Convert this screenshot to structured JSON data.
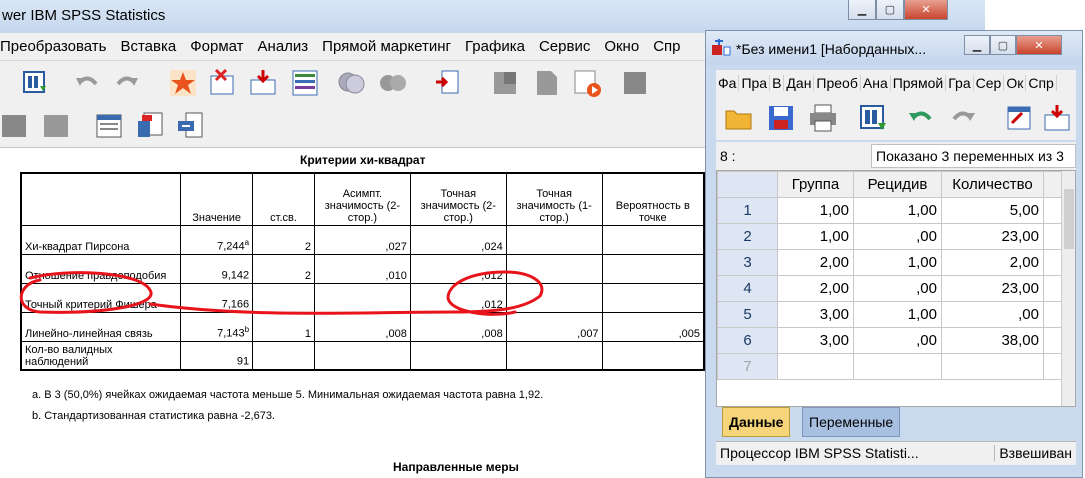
{
  "viewer": {
    "title": "wer IBM SPSS Statistics",
    "menu": [
      "Преобразовать",
      "Вставка",
      "Формат",
      "Анализ",
      "Прямой маркетинг",
      "Графика",
      "Сервис",
      "Окно",
      "Спр"
    ],
    "table_title": "Критерии хи-квадрат",
    "columns": [
      "",
      "Значение",
      "ст.св.",
      "Асимпт. значимость (2-стор.)",
      "Точная значимость (2-стор.)",
      "Точная значимость (1-стор.)",
      "Вероятность в точке"
    ],
    "rows": [
      {
        "label": "Хи-квадрат Пирсона",
        "value": "7,244",
        "sup": "a",
        "df": "2",
        "asymp": ",027",
        "exact2": ",024",
        "exact1": "",
        "prob": ""
      },
      {
        "label": "Отношение правдоподобия",
        "value": "9,142",
        "sup": "",
        "df": "2",
        "asymp": ",010",
        "exact2": ",012",
        "exact1": "",
        "prob": ""
      },
      {
        "label": "Точный критерий Фишера",
        "value": "7,166",
        "sup": "",
        "df": "",
        "asymp": "",
        "exact2": ",012",
        "exact1": "",
        "prob": ""
      },
      {
        "label": "Линейно-линейная связь",
        "value": "7,143",
        "sup": "b",
        "df": "1",
        "asymp": ",008",
        "exact2": ",008",
        "exact1": ",007",
        "prob": ",005"
      },
      {
        "label": "Кол-во валидных наблюдений",
        "value": "91",
        "sup": "",
        "df": "",
        "asymp": "",
        "exact2": "",
        "exact1": "",
        "prob": ""
      }
    ],
    "footnote_a": "a. В 3 (50,0%) ячейках ожидаемая частота меньше 5. Минимальная ожидаемая частота равна 1,92.",
    "footnote_b": "b. Стандартизованная статистика равна -2,673.",
    "next_title": "Направленные меры"
  },
  "editor": {
    "title": "*Без имени1 [Наборданных...",
    "menu": [
      "Фа",
      "Пра",
      "В",
      "Дан",
      "Преоб",
      "Ана",
      "Прямой",
      "Гра",
      "Сер",
      "Ок",
      "Спр"
    ],
    "cell_ref": "8 :",
    "shown_text": "Показано 3 переменных из 3",
    "columns": [
      "Группа",
      "Рецидив",
      "Количество"
    ],
    "rows": [
      {
        "n": "1",
        "c1": "1,00",
        "c2": "1,00",
        "c3": "5,00"
      },
      {
        "n": "2",
        "c1": "1,00",
        "c2": ",00",
        "c3": "23,00"
      },
      {
        "n": "3",
        "c1": "2,00",
        "c2": "1,00",
        "c3": "2,00"
      },
      {
        "n": "4",
        "c1": "2,00",
        "c2": ",00",
        "c3": "23,00"
      },
      {
        "n": "5",
        "c1": "3,00",
        "c2": "1,00",
        "c3": ",00"
      },
      {
        "n": "6",
        "c1": "3,00",
        "c2": ",00",
        "c3": "38,00"
      },
      {
        "n": "7",
        "c1": "",
        "c2": "",
        "c3": ""
      }
    ],
    "tab_data": "Данные",
    "tab_vars": "Переменные",
    "status_left": "Процессор IBM SPSS Statisti...",
    "status_right": "Взвешиван"
  },
  "colors": {
    "annotation": "#e8141c",
    "active_tab": "#f6d57a",
    "inactive_tab": "#a7c0e2"
  }
}
